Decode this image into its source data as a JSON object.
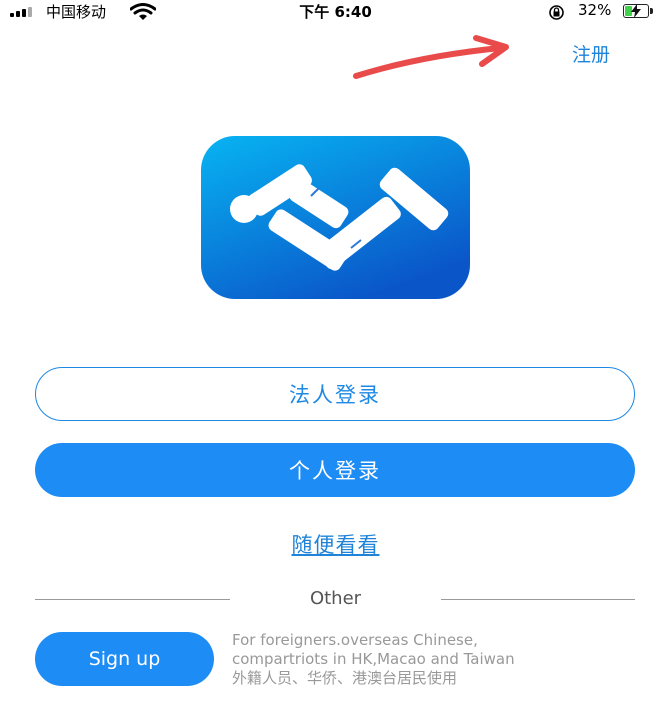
{
  "status_bar": {
    "carrier": "中国移动",
    "time": "下午 6:40",
    "battery_percent": "32%",
    "battery_level": 0.32,
    "icons": [
      "signal-bars-icon",
      "wifi-icon",
      "orientation-lock-icon",
      "battery-charging-icon"
    ]
  },
  "header": {
    "register_label": "注册"
  },
  "logo": {
    "icon": "app-logo-icon",
    "gradient_top": "#08b4f2",
    "gradient_bottom": "#0a56c9"
  },
  "login": {
    "legal_person_label": "法人登录",
    "personal_label": "个人登录",
    "browse_label": "随便看看"
  },
  "other": {
    "divider_label": "Other",
    "signup_label": "Sign up",
    "note_lines": [
      "For foreigners.overseas Chinese,",
      "compartriots in HK,Macao and Taiwan",
      "外籍人员、华侨、港澳台居民使用"
    ]
  },
  "colors": {
    "accent": "#1e8cf5",
    "link": "#1f84d9",
    "annotation_arrow": "#e94b4b"
  }
}
